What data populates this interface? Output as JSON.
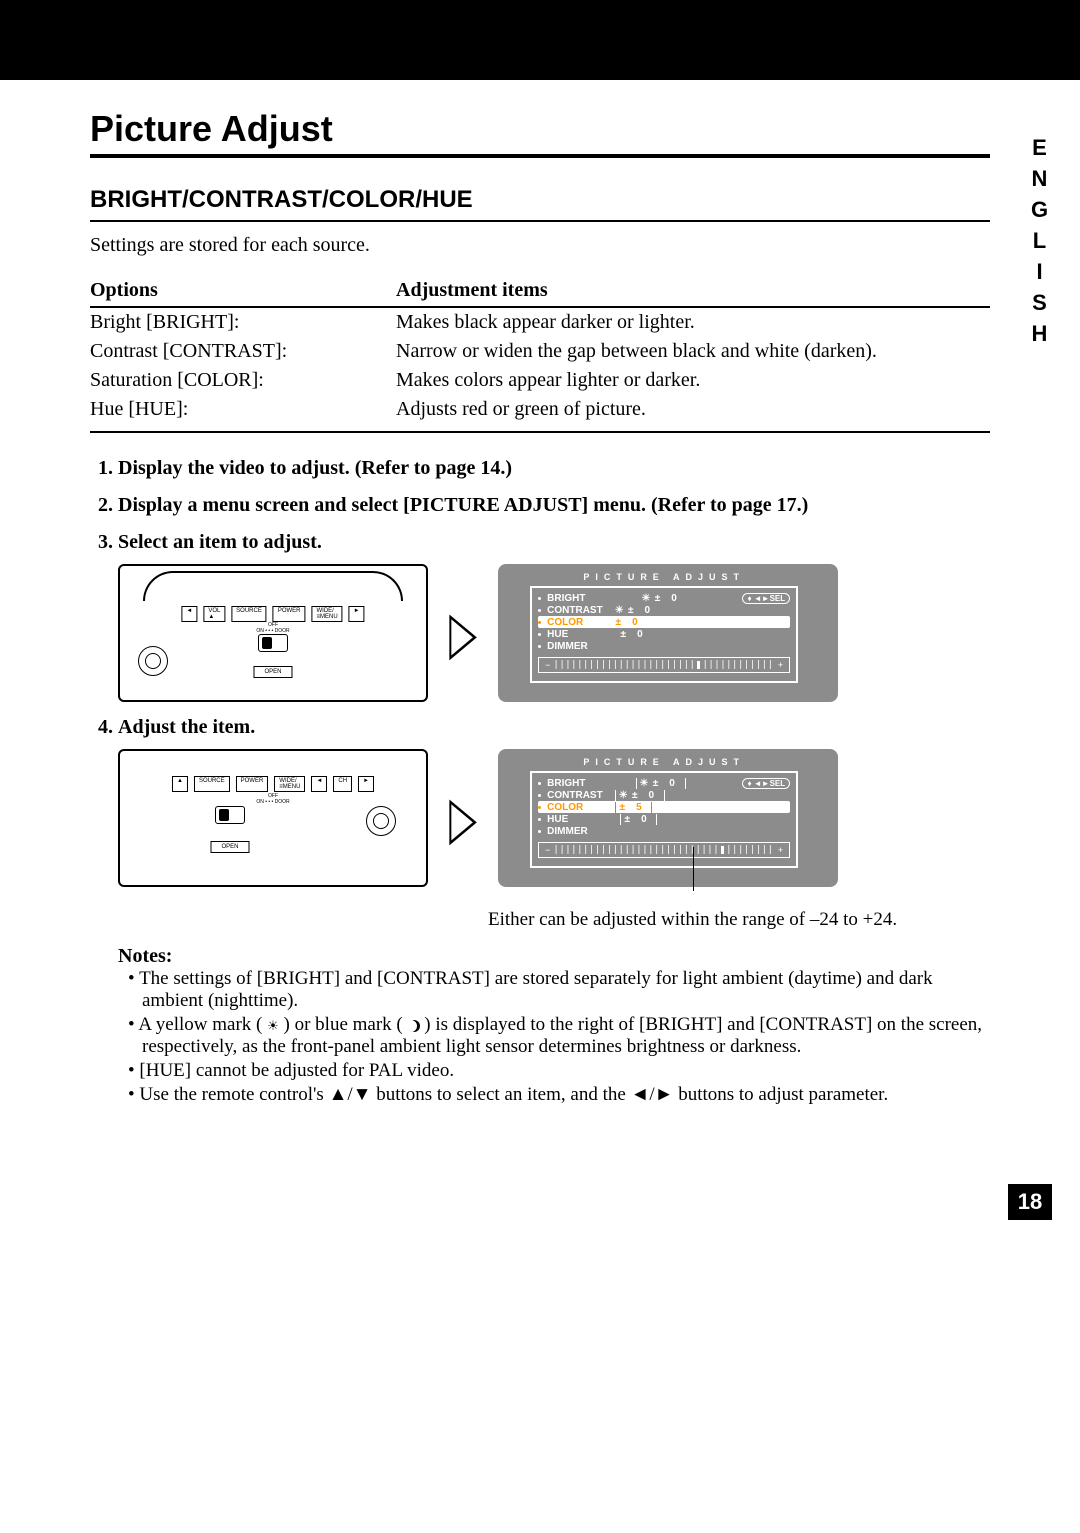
{
  "page": {
    "side_lang": "ENGLISH",
    "title": "Picture Adjust",
    "number": "18"
  },
  "section": {
    "heading": "BRIGHT/CONTRAST/COLOR/HUE",
    "intro": "Settings are stored for each source."
  },
  "table": {
    "header_options": "Options",
    "header_items": "Adjustment items",
    "rows": [
      {
        "opt": "Bright [BRIGHT]:",
        "desc": "Makes black appear darker or lighter."
      },
      {
        "opt": "Contrast [CONTRAST]:",
        "desc": "Narrow or widen the gap between black and white (darken)."
      },
      {
        "opt": "Saturation [COLOR]:",
        "desc": "Makes colors appear lighter or darker."
      },
      {
        "opt": "Hue [HUE]:",
        "desc": "Adjusts red or green of picture."
      }
    ]
  },
  "steps": {
    "s1": "Display the video to adjust. (Refer to page 14.)",
    "s2": "Display a menu screen and select [PICTURE ADJUST] menu. (Refer to page 17.)",
    "s3": "Select an item to adjust.",
    "s4": "Adjust the item."
  },
  "device": {
    "vol": "VOL",
    "source": "SOURCE",
    "power": "POWER",
    "wide_menu": "WIDE/≡MENU",
    "off": "OFF",
    "on_door": "ON • • • DOOR",
    "open": "OPEN",
    "ch": "CH"
  },
  "osd": {
    "title": "PICTURE ADJUST",
    "bright": "BRIGHT",
    "contrast": "CONTRAST",
    "color": "COLOR",
    "hue": "HUE",
    "dimmer": "DIMMER",
    "pm": "±",
    "zero": "0",
    "sel": "SEL",
    "five": "5"
  },
  "caption": {
    "text_before": "Either can be adjusted within the range of ",
    "range_low": "–24",
    "to": " to ",
    "range_high": "+24",
    "dot": "."
  },
  "notes": {
    "title": "Notes:",
    "n1": "The settings of [BRIGHT] and [CONTRAST] are stored separately for light ambient (daytime) and dark ambient (nighttime).",
    "n2a": "A yellow mark (",
    "n2b": ") or blue mark (",
    "n2c": ") is displayed to the right of [BRIGHT] and [CONTRAST] on the screen, respectively, as the front-panel ambient light sensor determines brightness or darkness.",
    "n3": "[HUE] cannot be adjusted for PAL video.",
    "n4a": "Use the remote control's ",
    "n4b": " buttons to select an item, and the ",
    "n4c": " buttons to adjust parameter.",
    "updn": "▲/▼",
    "lr": "◄/►"
  }
}
